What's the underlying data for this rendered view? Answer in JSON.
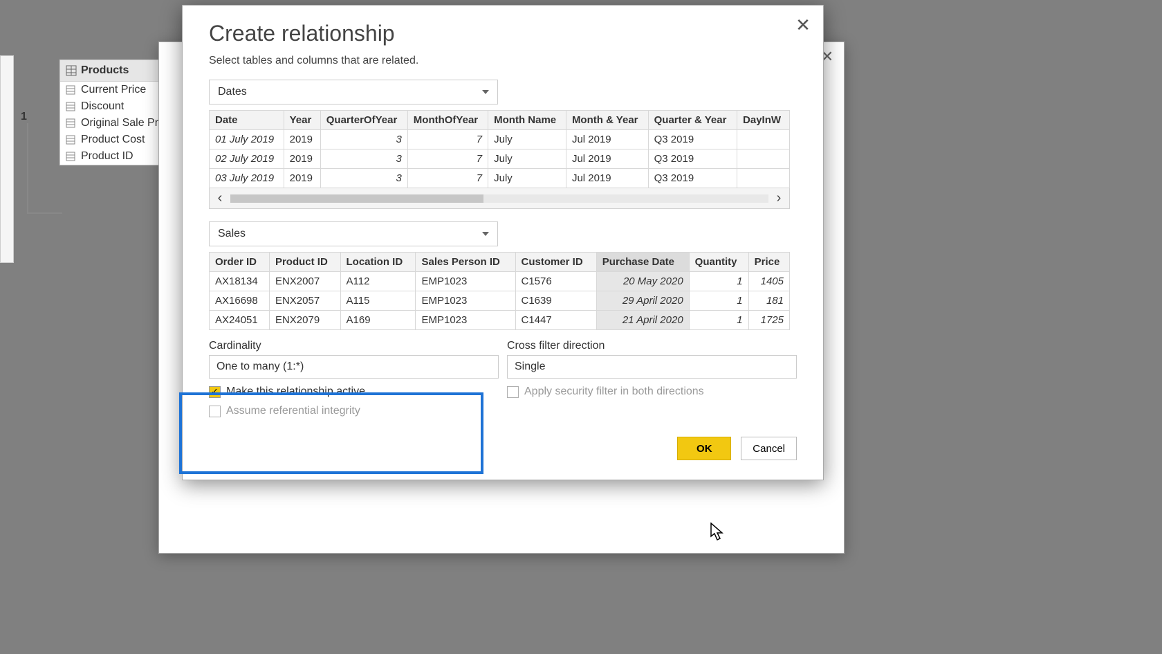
{
  "fields_panel": {
    "title": "Products",
    "items": [
      "Current Price",
      "Discount",
      "Original Sale Pri",
      "Product Cost",
      "Product ID"
    ]
  },
  "connector_label": "1",
  "dialog": {
    "title": "Create relationship",
    "subtitle": "Select tables and columns that are related.",
    "table1_select": "Dates",
    "table1": {
      "columns": [
        "Date",
        "Year",
        "QuarterOfYear",
        "MonthOfYear",
        "Month Name",
        "Month & Year",
        "Quarter & Year",
        "DayInW"
      ],
      "rows": [
        [
          "01 July 2019",
          "2019",
          "3",
          "7",
          "July",
          "Jul 2019",
          "Q3 2019",
          ""
        ],
        [
          "02 July 2019",
          "2019",
          "3",
          "7",
          "July",
          "Jul 2019",
          "Q3 2019",
          ""
        ],
        [
          "03 July 2019",
          "2019",
          "3",
          "7",
          "July",
          "Jul 2019",
          "Q3 2019",
          ""
        ]
      ]
    },
    "table2_select": "Sales",
    "table2": {
      "columns": [
        "Order ID",
        "Product ID",
        "Location ID",
        "Sales Person ID",
        "Customer ID",
        "Purchase Date",
        "Quantity",
        "Price"
      ],
      "highlight_col": 5,
      "rows": [
        [
          "AX18134",
          "ENX2007",
          "A112",
          "EMP1023",
          "C1576",
          "20 May 2020",
          "1",
          "1405"
        ],
        [
          "AX16698",
          "ENX2057",
          "A115",
          "EMP1023",
          "C1639",
          "29 April 2020",
          "1",
          "181"
        ],
        [
          "AX24051",
          "ENX2079",
          "A169",
          "EMP1023",
          "C1447",
          "21 April 2020",
          "1",
          "1725"
        ]
      ]
    },
    "cardinality_label": "Cardinality",
    "cardinality_value": "One to many (1:*)",
    "crossfilter_label": "Cross filter direction",
    "crossfilter_value": "Single",
    "chk_active": "Make this relationship active",
    "chk_security": "Apply security filter in both directions",
    "chk_integrity": "Assume referential integrity",
    "ok_label": "OK",
    "cancel_label": "Cancel"
  }
}
